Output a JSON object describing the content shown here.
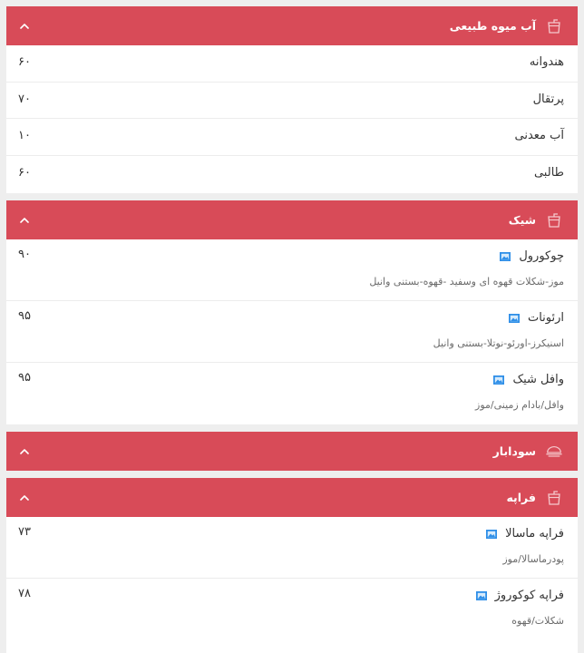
{
  "sections": [
    {
      "title": "آب میوه طبیعی",
      "icon": "drink-cup-icon",
      "items": [
        {
          "name": "هندوانه",
          "price": "۶۰"
        },
        {
          "name": "پرتقال",
          "price": "۷۰"
        },
        {
          "name": "آب معدنی",
          "price": "۱۰"
        },
        {
          "name": "طالبی",
          "price": "۶۰"
        }
      ]
    },
    {
      "title": "شیک",
      "icon": "drink-cup-icon",
      "items": [
        {
          "name": "چوکورول",
          "price": "۹۰",
          "description": "موز-شکلات قهوه ای وسفید -قهوه-بستنی وانیل"
        },
        {
          "name": "ارئونات",
          "price": "۹۵",
          "description": "اسنیکرز-اورئو-نوتلا-بستنی وانیل"
        },
        {
          "name": "وافل شیک",
          "price": "۹۵",
          "description": "وافل/بادام زمینی/موز"
        }
      ]
    },
    {
      "title": "سودابار",
      "icon": "food-dish-icon",
      "items": []
    },
    {
      "title": "فراپه",
      "icon": "drink-cup-icon",
      "items": [
        {
          "name": "فراپه ماسالا",
          "price": "۷۳",
          "description": "پودرماسالا/موز"
        },
        {
          "name": "فراپه کوکوروژ",
          "price": "۷۸",
          "description": "شکلات/قهوه"
        }
      ]
    }
  ],
  "colors": {
    "header_bg": "#d84b58",
    "page_bg": "#eeeeee",
    "image_icon": "#2f8fe8"
  }
}
